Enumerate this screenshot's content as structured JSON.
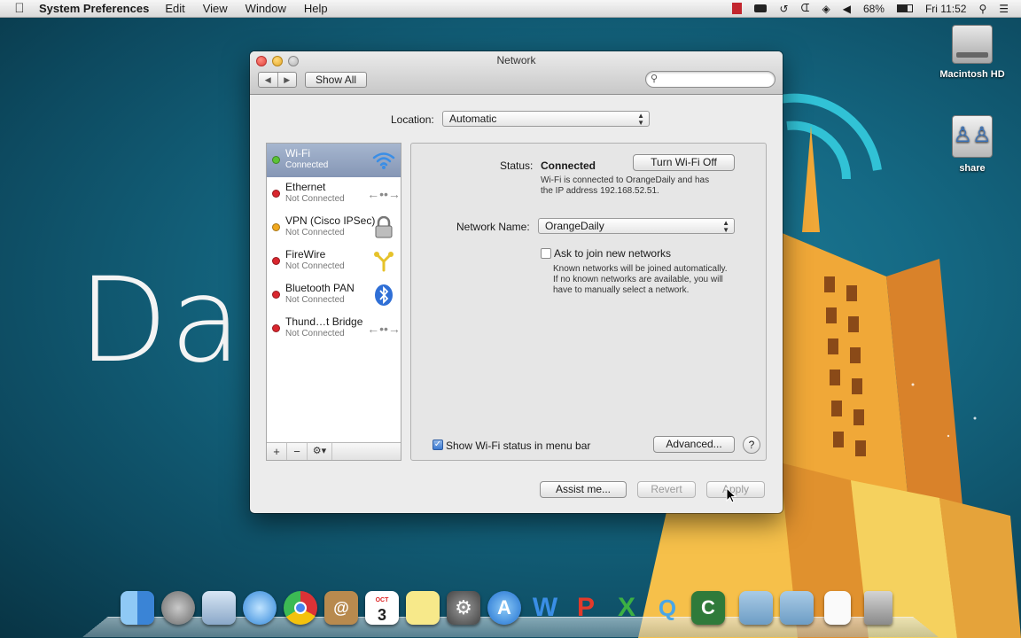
{
  "menubar": {
    "app_name": "System Preferences",
    "menus": [
      "Edit",
      "View",
      "Window",
      "Help"
    ],
    "battery": "68%",
    "clock": "Fri 11:52"
  },
  "desktop": {
    "wallpaper_text": "Dai",
    "icons": [
      {
        "label": "Macintosh HD"
      },
      {
        "label": "share"
      }
    ]
  },
  "window": {
    "title": "Network",
    "show_all": "Show All",
    "search_placeholder": "",
    "location_label": "Location:",
    "location_value": "Automatic",
    "services": [
      {
        "name": "Wi-Fi",
        "status": "Connected",
        "dot": "#5bc236",
        "icon": "wifi-icon"
      },
      {
        "name": "Ethernet",
        "status": "Not Connected",
        "dot": "#d9262e",
        "icon": "ethernet-icon"
      },
      {
        "name": "VPN (Cisco IPSec)",
        "status": "Not Connected",
        "dot": "#f0a81f",
        "icon": "lock-icon"
      },
      {
        "name": "FireWire",
        "status": "Not Connected",
        "dot": "#d9262e",
        "icon": "firewire-icon"
      },
      {
        "name": "Bluetooth PAN",
        "status": "Not Connected",
        "dot": "#d9262e",
        "icon": "bluetooth-icon"
      },
      {
        "name": "Thund…t Bridge",
        "status": "Not Connected",
        "dot": "#d9262e",
        "icon": "thunderbolt-icon"
      }
    ],
    "sidebar_buttons": {
      "add": "+",
      "remove": "−",
      "gear": "⚙▾"
    },
    "detail": {
      "status_label": "Status:",
      "status_value": "Connected",
      "turn_off_button": "Turn Wi-Fi Off",
      "status_desc_1": "Wi-Fi is connected to OrangeDaily and has",
      "status_desc_2": "the IP address 192.168.52.51.",
      "network_name_label": "Network Name:",
      "network_name_value": "OrangeDaily",
      "ask_join_label": "Ask to join new networks",
      "ask_join_desc_1": "Known networks will be joined automatically.",
      "ask_join_desc_2": "If no known networks are available, you will",
      "ask_join_desc_3": "have to manually select a network.",
      "show_status_label": "Show Wi-Fi status in menu bar",
      "advanced_button": "Advanced...",
      "help_button": "?"
    },
    "footer": {
      "assist_button": "Assist me...",
      "revert_button": "Revert",
      "apply_button": "Apply"
    }
  },
  "dock": {
    "items": [
      "finder-icon",
      "launchpad-icon",
      "mail-icon",
      "safari-icon",
      "chrome-icon",
      "contacts-icon",
      "calendar-icon",
      "notes-icon",
      "system-preferences-icon",
      "app-store-icon",
      "word-icon",
      "powerpoint-icon",
      "excel-icon",
      "messages-icon",
      "camtasia-icon",
      "applications-folder-icon",
      "documents-folder-icon",
      "document-icon",
      "trash-icon"
    ],
    "calendar_day": "3",
    "calendar_month": "OCT"
  },
  "colors": {
    "desktop": "#156a85",
    "building": "#f2a93b",
    "selection": "#8b9cba"
  }
}
